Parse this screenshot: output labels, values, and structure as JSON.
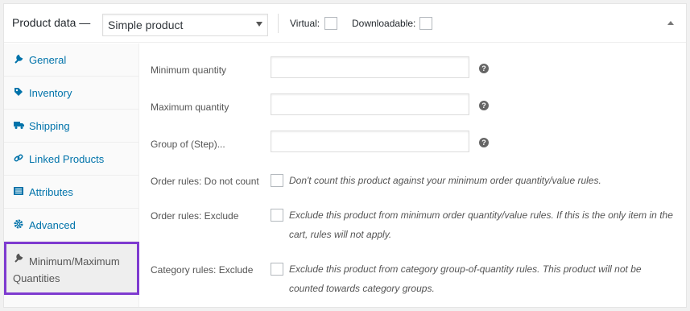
{
  "header": {
    "title": "Product data —",
    "product_type": "Simple product",
    "virtual_label": "Virtual:",
    "downloadable_label": "Downloadable:"
  },
  "tabs": [
    {
      "label": "General",
      "icon": "wrench-icon"
    },
    {
      "label": "Inventory",
      "icon": "tag-icon"
    },
    {
      "label": "Shipping",
      "icon": "truck-icon"
    },
    {
      "label": "Linked Products",
      "icon": "link-icon"
    },
    {
      "label": "Attributes",
      "icon": "list-icon"
    },
    {
      "label": "Advanced",
      "icon": "gear-icon"
    },
    {
      "label": "Minimum/Maximum Quantities",
      "icon": "wrench-icon",
      "active": true
    }
  ],
  "fields": {
    "min_qty": {
      "label": "Minimum quantity",
      "value": ""
    },
    "max_qty": {
      "label": "Maximum quantity",
      "value": ""
    },
    "group_of": {
      "label": "Group of (Step)...",
      "value": ""
    },
    "order_rules_count": {
      "label": "Order rules: Do not count",
      "description": "Don't count this product against your minimum order quantity/value rules."
    },
    "order_rules_exclude": {
      "label": "Order rules: Exclude",
      "description": "Exclude this product from minimum order quantity/value rules. If this is the only item in the cart, rules will not apply."
    },
    "category_rules_exclude": {
      "label": "Category rules: Exclude",
      "description": "Exclude this product from category group-of-quantity rules. This product will not be counted towards category groups."
    }
  },
  "help_symbol": "?",
  "colors": {
    "link": "#0073aa",
    "active_outline": "#7e3bd0"
  }
}
